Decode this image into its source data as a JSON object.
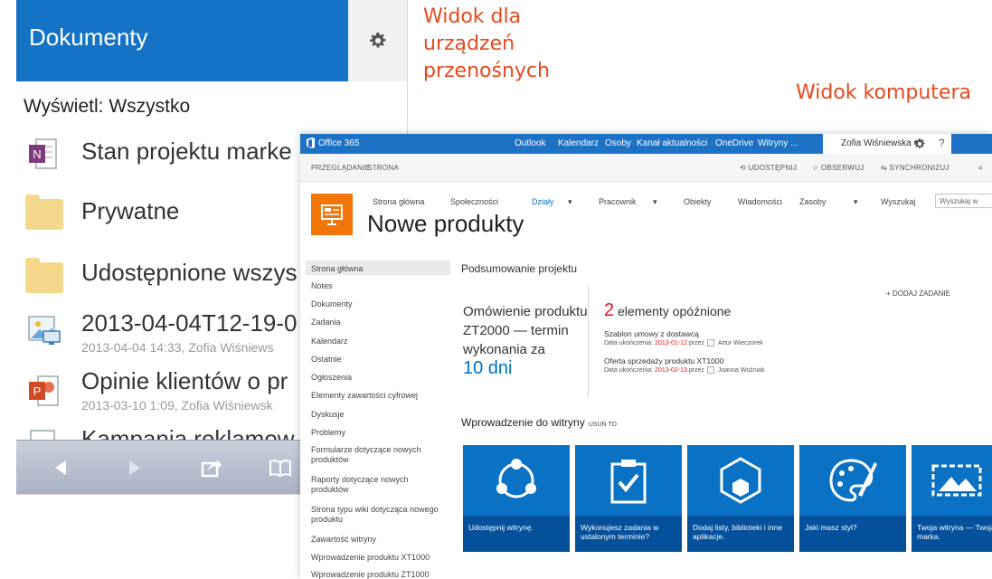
{
  "callouts": {
    "mobile": "Widok dla urządzeń przenośnych",
    "desktop": "Widok komputera"
  },
  "mobile": {
    "title": "Dokumenty",
    "filter": "Wyświetl: Wszystko",
    "items": [
      {
        "name": "Stan projektu marke",
        "sub": "",
        "icon": "onenote-icon"
      },
      {
        "name": "Prywatne",
        "sub": "",
        "icon": "folder-icon"
      },
      {
        "name": "Udostępnione wszys",
        "sub": "",
        "icon": "folder-icon"
      },
      {
        "name": "2013-04-04T12-19-0",
        "sub": "2013-04-04 14:33, Zofia Wiśniews",
        "icon": "image-icon"
      },
      {
        "name": "Opinie klientów o pr",
        "sub": "2013-03-10 1:09, Zofia Wiśniewsk",
        "icon": "powerpoint-icon"
      },
      {
        "name": "Kampania reklamow",
        "sub": "",
        "icon": "document-icon"
      }
    ]
  },
  "desktop": {
    "suite": {
      "brand": "Office 365",
      "links": [
        "Outlook",
        "Kalendarz",
        "Osoby",
        "Kanał aktualności",
        "OneDrive",
        "Witryny",
        "..."
      ],
      "user": "Zofia Wiśniewska ▾"
    },
    "ribbon": {
      "tabs": [
        "PRZEGLĄDANIE",
        "STRONA"
      ],
      "actions": [
        "UDOSTĘPNIJ",
        "OBSERWUJ",
        "SYNCHRONIZUJ"
      ]
    },
    "topnav": [
      "Strona główna",
      "Społeczności",
      "Działy",
      "Pracownik",
      "Obiekty",
      "Wiadomości",
      "Zasoby",
      "Wyszukaj"
    ],
    "search_placeholder": "Wyszukaj w",
    "site_title": "Nowe produkty",
    "quicklaunch": [
      "Strona główna",
      "Notes",
      "Dokumenty",
      "Zadania",
      "Kalendarz",
      "Ostatnie",
      "Ogłoszenia",
      "Elementy zawartości cyfrowej",
      "Dyskusje",
      "Problemy",
      "Formularze dotyczące nowych produktów",
      "Raporty dotyczące nowych produktów",
      "Strona typu wiki dotycząca nowego produktu",
      "Zawartość witryny",
      "Wprowadzenie produktu XT1000",
      "Wprowadzenie produktu ZT1000"
    ],
    "project": {
      "title": "Podsumowanie projektu",
      "countdown_text": "Omówienie produktu ZT2000 — termin wykonania za",
      "countdown_value": "10 dni",
      "late_count": "2",
      "late_label": "elementy opóźnione",
      "add_task": "+ DODAJ ZADANIE",
      "tasks": [
        {
          "title": "Szablon umowy z dostawcą",
          "due_label": "Data ukończenia:",
          "date": "2013-01-12",
          "by": "przez",
          "person": "Artur Wieczorek"
        },
        {
          "title": "Oferta sprzedaży produktu XT1000",
          "due_label": "Data ukończenia:",
          "date": "2013-02-13",
          "by": "przez",
          "person": "Joanna Woźniak"
        }
      ]
    },
    "intro": {
      "title": "Wprowadzenie do witryny",
      "remove": "USUŃ TO",
      "tiles": [
        {
          "caption": "Udostępnij witrynę.",
          "icon": "share-icon"
        },
        {
          "caption": "Wykonujesz zadania w ustalonym terminie?",
          "icon": "clipboard-check-icon"
        },
        {
          "caption": "Dodaj listy, biblioteki i inne aplikacje.",
          "icon": "apps-icon"
        },
        {
          "caption": "Jaki masz styl?",
          "icon": "palette-icon"
        },
        {
          "caption": "Twoja witryna — Twoja marka.",
          "icon": "image-brand-icon"
        }
      ]
    }
  }
}
